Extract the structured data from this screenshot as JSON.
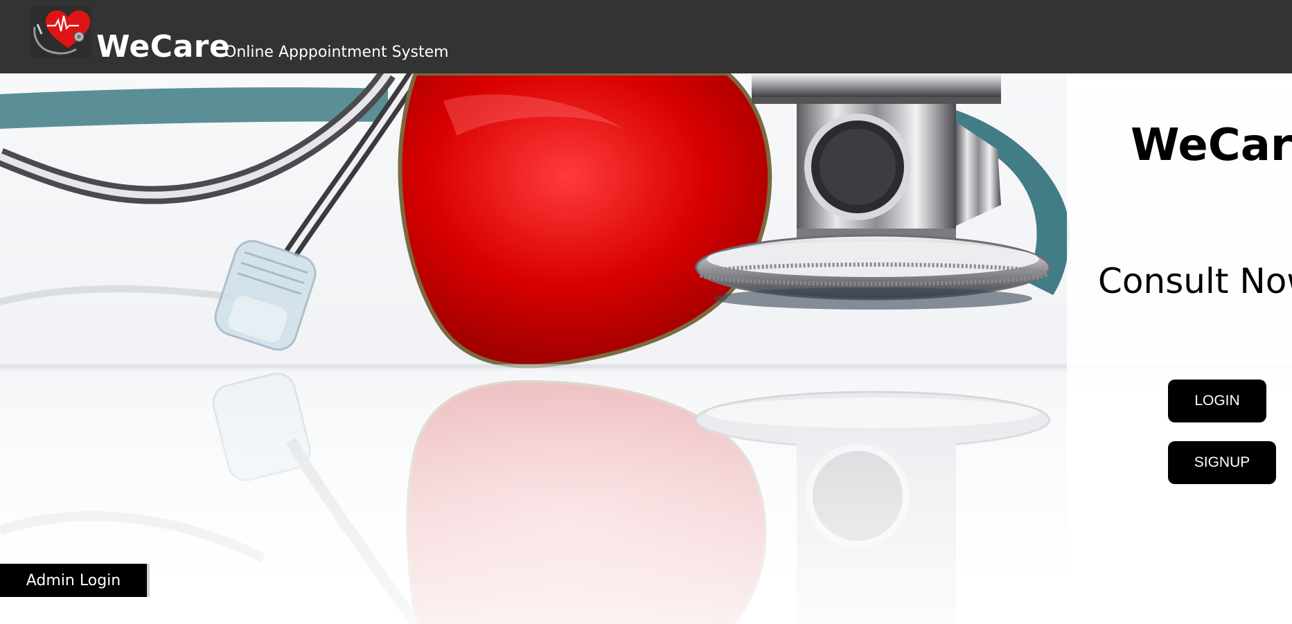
{
  "header": {
    "logo_icon": "heart-stethoscope-icon",
    "brand": "WeCare",
    "tagline": "Online Apppointment System"
  },
  "hero": {
    "image": "stethoscope-heart-photo",
    "title": "WeCare",
    "subtitle": "Consult Now",
    "login_label": "LOGIN",
    "signup_label": "SIGNUP",
    "admin_label": "Admin Login"
  },
  "colors": {
    "header_bg": "#333333",
    "button_bg": "#000000",
    "button_text": "#ffffff",
    "heart_red": "#d40000"
  }
}
